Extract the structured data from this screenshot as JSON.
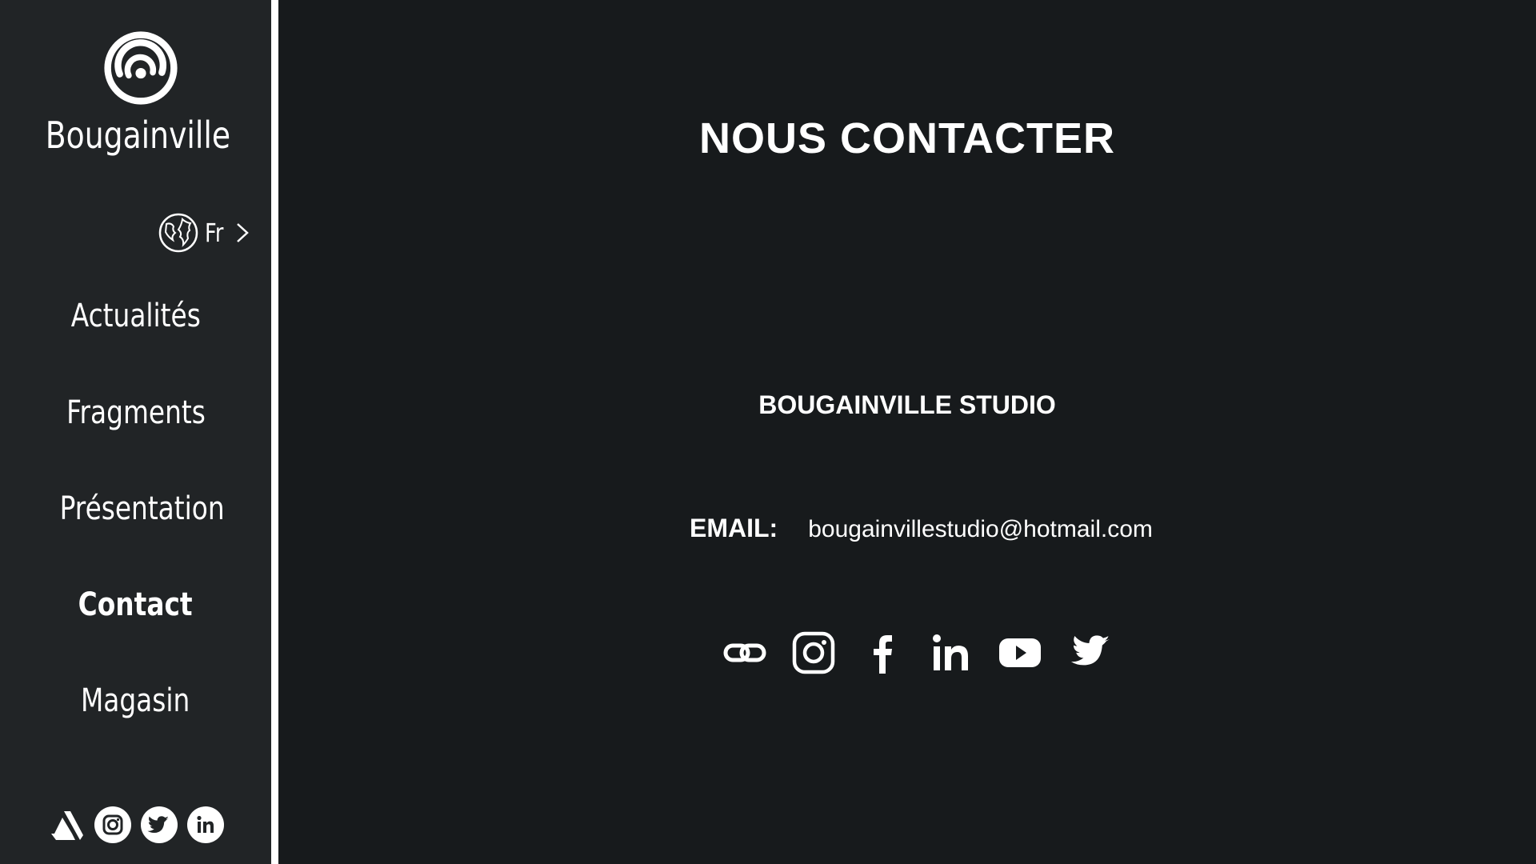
{
  "sidebar": {
    "brand": "Bougainville",
    "language": {
      "label": "Fr",
      "icon": "globe-icon",
      "chevron": "chevron-right-icon"
    },
    "nav": [
      {
        "label": "Actualités",
        "active": false
      },
      {
        "label": "Fragments",
        "active": false
      },
      {
        "label": "Présentation",
        "active": false
      },
      {
        "label": "Contact",
        "active": true
      },
      {
        "label": "Magasin",
        "active": false
      }
    ],
    "social_icons": [
      "artstation-icon",
      "instagram-icon",
      "twitter-icon",
      "linkedin-icon"
    ]
  },
  "main": {
    "title": "NOUS CONTACTER",
    "studio_name": "BOUGAINVILLE STUDIO",
    "email_label": "EMAIL:",
    "email_value": "bougainvillestudio@hotmail.com",
    "social_icons": [
      "link-icon",
      "instagram-icon",
      "facebook-icon",
      "linkedin-icon",
      "youtube-icon",
      "twitter-icon"
    ]
  },
  "colors": {
    "background": "#171a1c",
    "sidebar": "#212426",
    "text": "#ffffff",
    "divider": "#ffffff"
  }
}
